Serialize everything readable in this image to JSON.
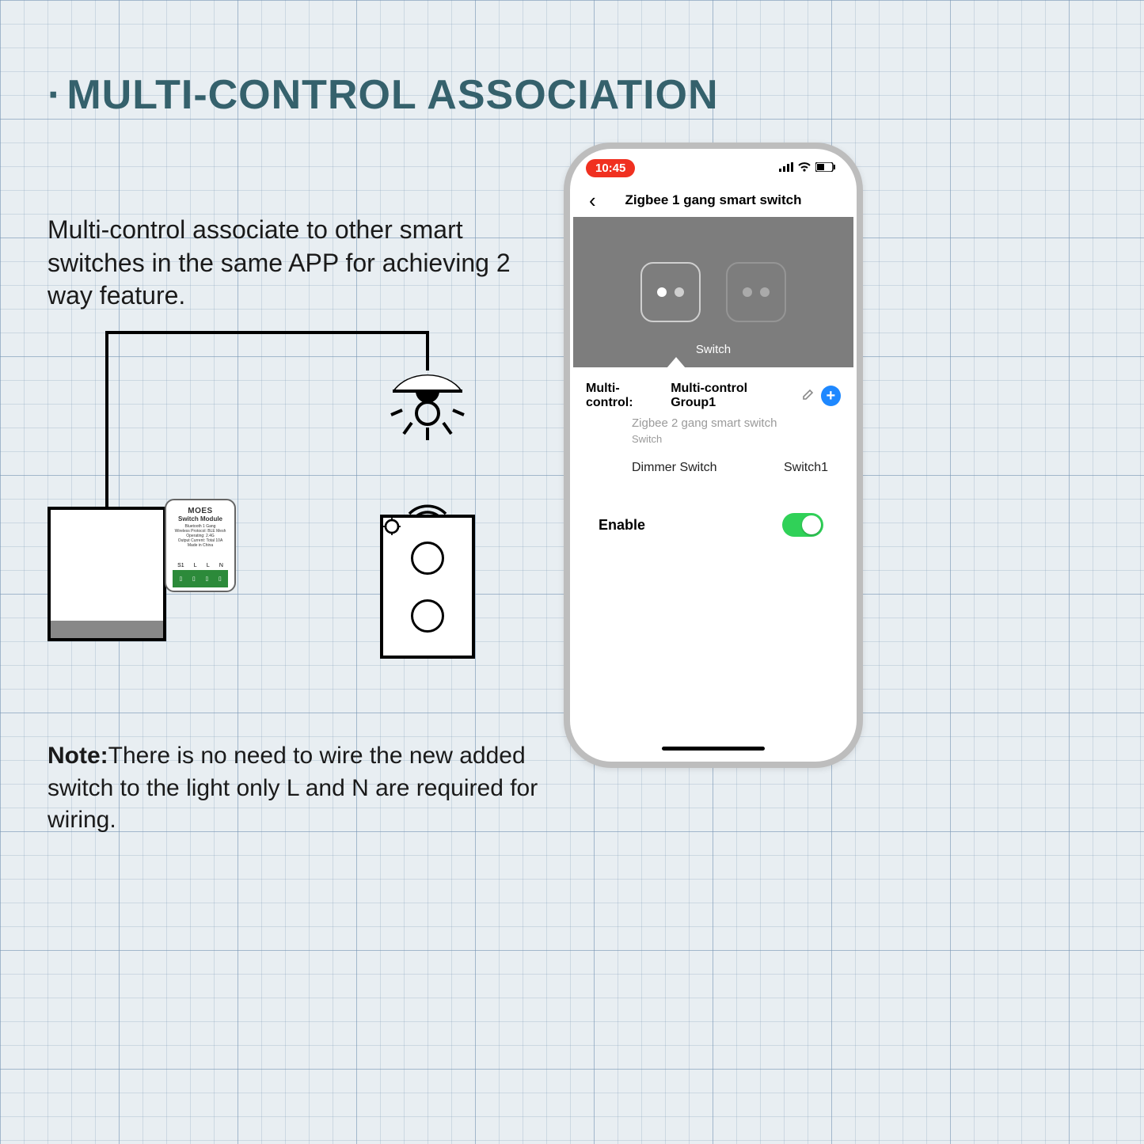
{
  "heading": "MULTI-CONTROL ASSOCIATION",
  "description": "Multi-control associate to other smart switches in the same APP for achieving 2 way feature.",
  "note_label": "Note:",
  "note_text": "There is no need to wire the new added switch to the light only L and N are required for wiring.",
  "module": {
    "brand": "MOES",
    "model": "Switch Module",
    "specs": "Bluetooth 1 Gang\nWireless Protocol: BLE Mesh\nOperating: 2.4G\nOutput Current: Total 10A\nMade in China",
    "terminals": [
      "S1",
      "L",
      "L",
      "N"
    ]
  },
  "phone": {
    "time": "10:45",
    "page_title": "Zigbee 1 gang smart switch",
    "hero_label": "Switch",
    "mc_prefix": "Multi-control:",
    "mc_group": "Multi-control Group1",
    "items": [
      {
        "name": "Zigbee 2 gang smart switch",
        "sub": "Switch"
      },
      {
        "name": "Dimmer Switch",
        "right": "Switch1"
      }
    ],
    "enable_label": "Enable",
    "enable_on": true
  }
}
